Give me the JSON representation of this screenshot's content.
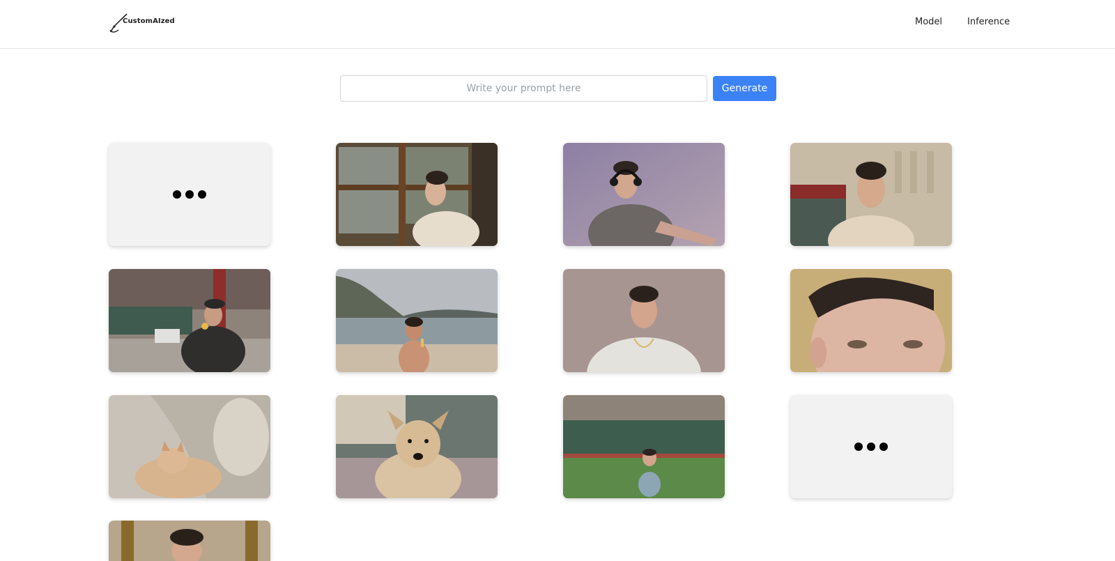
{
  "brand": {
    "name": "CustomAIzed",
    "logo_icon": "customaized-logo-icon"
  },
  "nav": {
    "items": [
      {
        "label": "Model"
      },
      {
        "label": "Inference"
      }
    ]
  },
  "prompt": {
    "placeholder": "Write your prompt here",
    "value": "",
    "button_label": "Generate"
  },
  "gallery": {
    "cards": [
      {
        "status": "loading",
        "subject": ""
      },
      {
        "status": "image",
        "subject": "man-cafe-window"
      },
      {
        "status": "image",
        "subject": "man-headphones"
      },
      {
        "status": "image",
        "subject": "man-street-hoodie"
      },
      {
        "status": "image",
        "subject": "man-eating-street"
      },
      {
        "status": "image",
        "subject": "boy-beach"
      },
      {
        "status": "image",
        "subject": "man-tshirt-portrait"
      },
      {
        "status": "image",
        "subject": "face-closeup"
      },
      {
        "status": "image",
        "subject": "cat-on-couch"
      },
      {
        "status": "image",
        "subject": "dog-portrait"
      },
      {
        "status": "image",
        "subject": "kid-soccer-field"
      },
      {
        "status": "loading",
        "subject": ""
      },
      {
        "status": "image",
        "subject": "man-portrait-partial"
      }
    ]
  }
}
